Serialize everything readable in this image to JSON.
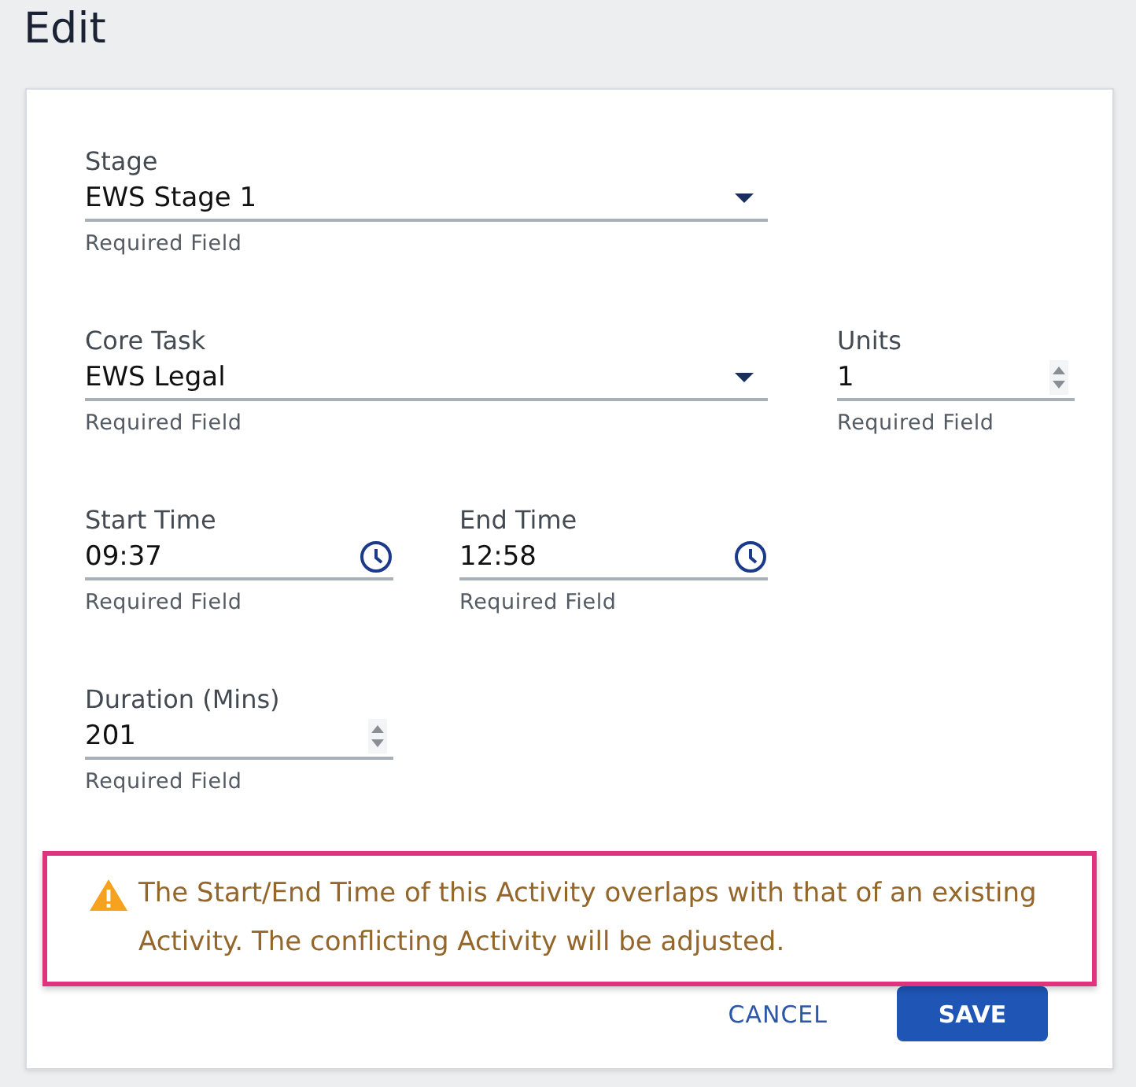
{
  "title": "Edit",
  "rows": [
    [
      {
        "kind": "select",
        "label": "Stage",
        "value": "EWS Stage 1",
        "helper": "Required Field"
      }
    ],
    [
      {
        "kind": "select",
        "label": "Core Task",
        "value": "EWS Legal",
        "helper": "Required Field"
      },
      {
        "kind": "number",
        "label": "Units",
        "value": "1",
        "helper": "Required Field"
      }
    ],
    [
      {
        "kind": "time",
        "label": "Start Time",
        "value": "09:37",
        "helper": "Required Field"
      },
      {
        "kind": "time",
        "label": "End Time",
        "value": "12:58",
        "helper": "Required Field"
      }
    ],
    [
      {
        "kind": "number",
        "label": "Duration (Mins)",
        "value": "201",
        "helper": "Required Field"
      }
    ]
  ],
  "warning": {
    "text": "The Start/End Time of this Activity overlaps with that of an existing Activity. The conflicting Activity will be adjusted."
  },
  "buttons": [
    {
      "kind": "text",
      "label": "CANCEL"
    },
    {
      "kind": "primary",
      "label": "SAVE"
    }
  ]
}
